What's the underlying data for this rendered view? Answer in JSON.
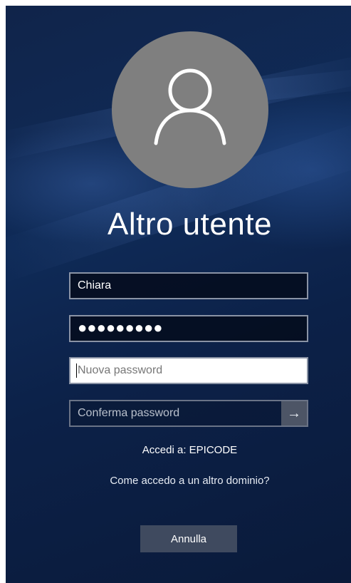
{
  "profile": {
    "avatar_icon": "user-silhouette-icon",
    "title": "Altro utente"
  },
  "form": {
    "username_value": "Chiara",
    "password_value": "●●●●●●●●●",
    "new_password_placeholder": "Nuova password",
    "confirm_password_placeholder": "Conferma password",
    "submit_icon": "arrow-right-icon",
    "submit_glyph": "→"
  },
  "footer": {
    "domain_text": "Accedi a: EPICODE",
    "help_link": "Come accedo a un altro dominio?",
    "cancel_label": "Annulla"
  },
  "colors": {
    "background": "#0f2b58",
    "avatar": "#7f7f7f",
    "button": "#3f4a5f"
  }
}
